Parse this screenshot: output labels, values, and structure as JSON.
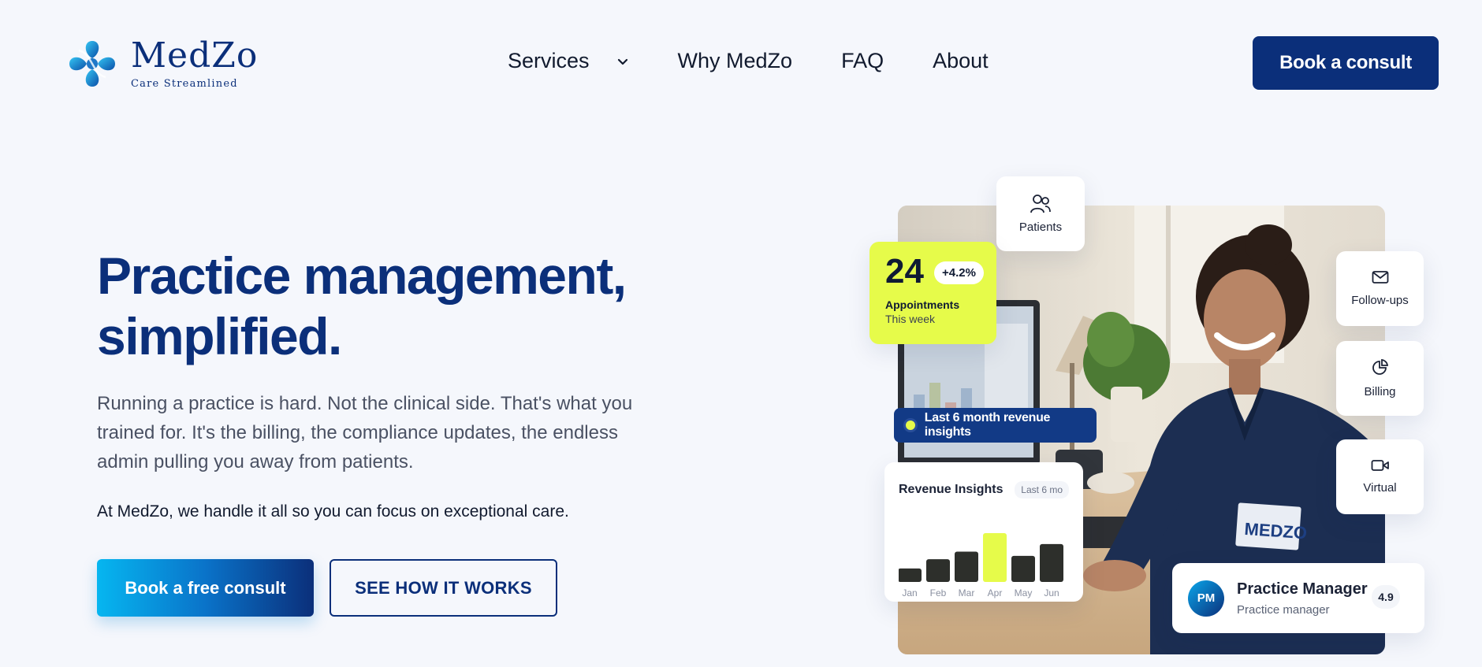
{
  "brand": {
    "name": "MedZo",
    "tagline": "Care Streamlined",
    "colors": {
      "primary": "#0b2f7a",
      "accent": "#06b6f0",
      "highlight": "#e6fb4a",
      "background": "#f5f7fc"
    }
  },
  "nav": {
    "items": [
      {
        "label": "Services",
        "has_dropdown": true
      },
      {
        "label": "Why MedZo"
      },
      {
        "label": "FAQ"
      },
      {
        "label": "About"
      }
    ],
    "cta_label": "Book a consult"
  },
  "hero": {
    "title_line1": "Practice management,",
    "title_line2": "simplified.",
    "paragraph": "Running a practice is hard. Not the clinical side. That's what you trained for. It's the billing, the compliance updates, the endless admin pulling you away from patients.",
    "subtext": "At MedZo, we handle it all so you can focus on exceptional care.",
    "primary_cta": "Book a free consult",
    "secondary_cta": "SEE HOW IT WORKS"
  },
  "visual": {
    "patients_card": {
      "label": "Patients",
      "icon": "users-icon"
    },
    "appointments_card": {
      "value": "24",
      "change": "+4.2%",
      "label": "Appointments",
      "period": "This week"
    },
    "side_cards": [
      {
        "label": "Follow-ups",
        "icon": "mail-icon"
      },
      {
        "label": "Billing",
        "icon": "pie-chart-icon"
      },
      {
        "label": "Virtual",
        "icon": "video-icon"
      }
    ],
    "insights_pill": "Last 6 month revenue insights",
    "revenue_card": {
      "title": "Revenue Insights",
      "range": "Last 6 mo",
      "chart_data": {
        "type": "bar",
        "categories": [
          "Jan",
          "Feb",
          "Mar",
          "Apr",
          "May",
          "Jun"
        ],
        "values": [
          16,
          27,
          36,
          58,
          31,
          45
        ],
        "highlight_index": 3,
        "bar_color": "#2d2f2b",
        "highlight_color": "#e6fb4a"
      }
    },
    "manager_card": {
      "initials": "PM",
      "name": "Practice Manager",
      "role": "Practice manager",
      "rating": "4.9"
    }
  }
}
